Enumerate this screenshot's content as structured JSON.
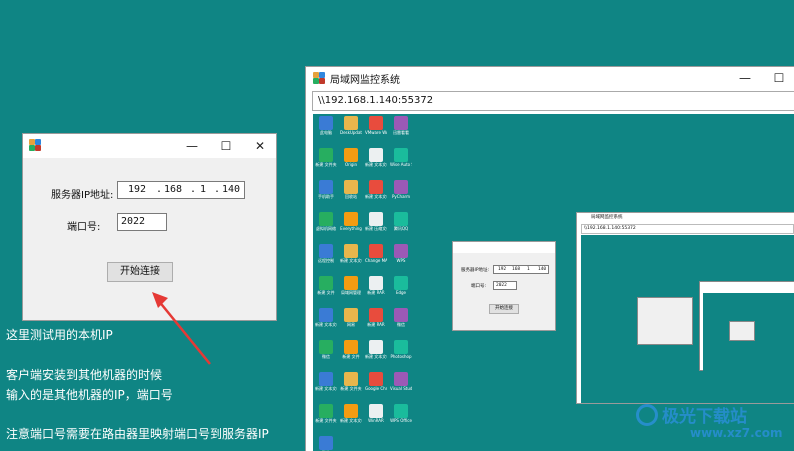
{
  "client_window": {
    "server_ip_label": "服务器IP地址:",
    "ip_octets": [
      "192",
      "168",
      "1",
      "140"
    ],
    "port_label": "端口号:",
    "port_value": "2022",
    "connect_button": "开始连接",
    "minimize": "—",
    "maximize": "☐",
    "close": "✕"
  },
  "annotations": {
    "line1": "这里测试用的本机IP",
    "line2": "客户端安装到其他机器的时候",
    "line3": "输入的是其他机器的IP，端口号",
    "line4": "注意端口号需要在路由器里映射端口号到服务器IP"
  },
  "monitor_window": {
    "title": "局域网监控系统",
    "address": "\\\\192.168.1.140:55372",
    "minimize": "—",
    "maximize": "☐"
  },
  "remote_desktop_icons": [
    "此电脑",
    "DeskUpdate",
    "VMware Workstation",
    "迅雷看看",
    "新建 文件夹",
    "Origin",
    "新建 文本文档",
    "Wise Auto Shutdown",
    "手机助手",
    "回收站",
    "新建 文本文档",
    "PyCharm",
    "虚拟机网络",
    "Everything",
    "新建 压缩文件",
    "腾讯QQ",
    "远程控制",
    "新建 文本文档",
    "Change MAC",
    "WPS",
    "新建 文件",
    "局域网管理",
    "新建 RAR",
    "Edge",
    "新建 文本文档",
    "网易",
    "新建 RAR",
    "微信",
    "微信",
    "新建 文件",
    "新建 文本文档",
    "Photoshop",
    "新建 文本文档",
    "新建 文件夹",
    "Google Chrome",
    "Visual Studio",
    "新建 文件夹",
    "新建 文本文档",
    "WinRAR",
    "WPS Office",
    "微信"
  ],
  "nested_window": {
    "server_ip_label": "服务器IP地址:",
    "ip_octets": [
      "192",
      "168",
      "1",
      "140"
    ],
    "port_label": "端口号:",
    "port_value": "2022",
    "connect_button": "开始连接"
  },
  "nested_monitor": {
    "title": "局域网监控系统",
    "address": "\\\\192.168.1.140:55372"
  },
  "watermark": "极光下载站",
  "watermark_url": "www.xz7.com",
  "colors": {
    "desktop": "#0f8584",
    "annotation_text": "#ffffff",
    "arrow": "#e53935"
  }
}
